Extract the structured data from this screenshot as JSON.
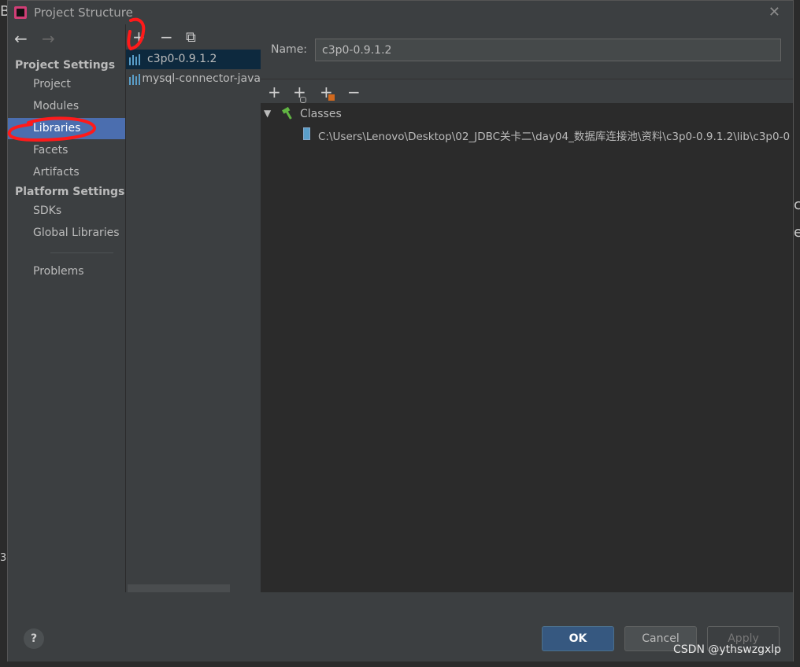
{
  "background": {
    "left_char_top": "B",
    "left_char_mid": "3",
    "right_char_1": "c",
    "right_char_2": "e"
  },
  "window": {
    "title": "Project Structure",
    "close_glyph": "✕",
    "app_icon": "intellij-icon"
  },
  "nav": {
    "back_glyph": "←",
    "forward_glyph": "→",
    "project_settings_header": "Project Settings",
    "project_items": [
      "Project",
      "Modules",
      "Libraries",
      "Facets",
      "Artifacts"
    ],
    "platform_settings_header": "Platform Settings",
    "platform_items": [
      "SDKs",
      "Global Libraries"
    ],
    "problems": "Problems",
    "selected": "Libraries"
  },
  "library_toolbar": {
    "add": "+",
    "remove": "−",
    "copy": "⧉"
  },
  "libraries": [
    {
      "name": "c3p0-0.9.1.2",
      "selected": true
    },
    {
      "name": "mysql-connector-java",
      "selected": false
    }
  ],
  "detail": {
    "name_label": "Name:",
    "name_value": "c3p0-0.9.1.2",
    "toolbar": {
      "add": "+",
      "add_alt": "+",
      "add_with_extra": "+",
      "remove": "−"
    },
    "tree": {
      "node_label": "Classes",
      "path": "C:\\Users\\Lenovo\\Desktop\\02_JDBC关卡二\\day04_数据库连接池\\资料\\c3p0-0.9.1.2\\lib\\c3p0-0"
    }
  },
  "footer": {
    "help": "?",
    "ok": "OK",
    "cancel": "Cancel",
    "apply": "Apply"
  },
  "watermark": "CSDN @ythswzgxlp",
  "colors": {
    "accent": "#4b6eaf",
    "selection": "#0d293e",
    "annotation": "#ff1a1a"
  }
}
